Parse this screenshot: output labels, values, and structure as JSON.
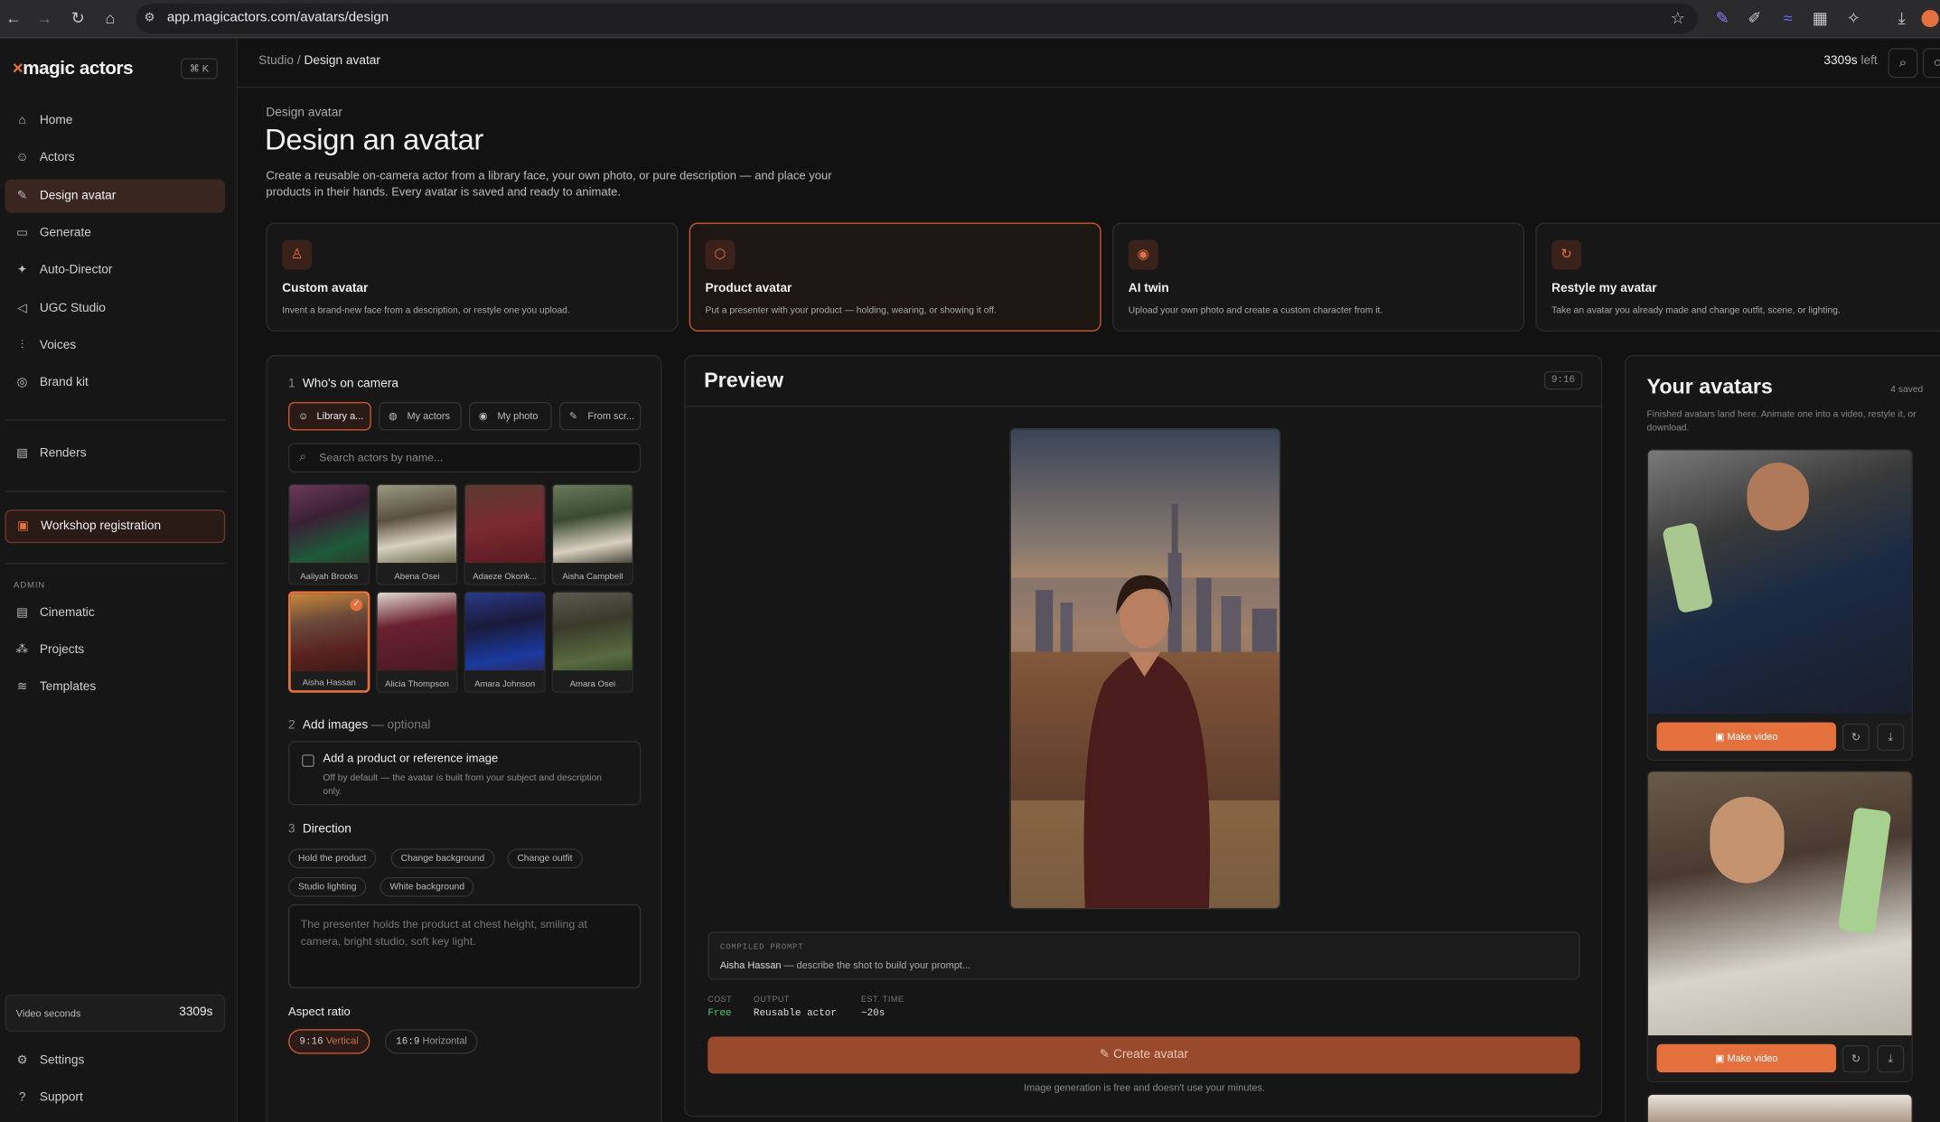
{
  "browser": {
    "url": "app.magicactors.com/avatars/design"
  },
  "sidebar": {
    "logo": "magic actors",
    "shortcut": "⌘ K",
    "items": [
      {
        "label": "Home",
        "icon": "home-icon"
      },
      {
        "label": "Actors",
        "icon": "users-icon"
      },
      {
        "label": "Design avatar",
        "icon": "wand-icon"
      },
      {
        "label": "Generate",
        "icon": "video-icon"
      },
      {
        "label": "Auto-Director",
        "icon": "sparkle-icon"
      },
      {
        "label": "UGC Studio",
        "icon": "megaphone-icon"
      },
      {
        "label": "Voices",
        "icon": "waveform-icon"
      },
      {
        "label": "Brand kit",
        "icon": "palette-icon"
      },
      {
        "label": "Renders",
        "icon": "film-icon"
      }
    ],
    "workshop": "Workshop registration",
    "admin_label": "ADMIN",
    "admin_items": [
      {
        "label": "Cinematic"
      },
      {
        "label": "Projects"
      },
      {
        "label": "Templates"
      }
    ],
    "video_seconds_label": "Video seconds",
    "video_seconds_value": "3309s",
    "settings": "Settings",
    "support": "Support"
  },
  "topbar": {
    "crumb_root": "Studio",
    "crumb_sep": "/",
    "crumb_current": "Design avatar",
    "seconds_left": "3309s",
    "seconds_left_suffix": "left"
  },
  "header": {
    "eyebrow": "Design avatar",
    "title": "Design an avatar",
    "description": "Create a reusable on-camera actor from a library face, your own photo, or pure description — and place your products in their hands. Every avatar is saved and ready to animate."
  },
  "modes": [
    {
      "title": "Custom avatar",
      "desc": "Invent a brand-new face from a description, or restyle one you upload.",
      "icon": "person-icon"
    },
    {
      "title": "Product avatar",
      "desc": "Put a presenter with your product — holding, wearing, or showing it off.",
      "icon": "box-icon"
    },
    {
      "title": "AI twin",
      "desc": "Upload your own photo and create a custom character from it.",
      "icon": "camera-icon"
    },
    {
      "title": "Restyle my avatar",
      "desc": "Take an avatar you already made and change outfit, scene, or lighting.",
      "icon": "refresh-icon"
    }
  ],
  "who": {
    "num": "1",
    "title": "Who's on camera",
    "tabs": [
      "Library a...",
      "My actors",
      "My photo",
      "From scr..."
    ],
    "search_placeholder": "Search actors by name...",
    "actors": [
      "Aaliyah Brooks",
      "Abena Osei",
      "Adaeze Okonk...",
      "Aisha Campbell",
      "Aisha Hassan",
      "Alicia Thompson",
      "Amara Johnson",
      "Amara Osei"
    ]
  },
  "images": {
    "num": "2",
    "title": "Add images",
    "optional": "— optional",
    "checkbox_label": "Add a product or reference image",
    "checkbox_desc": "Off by default — the avatar is built from your subject and description only."
  },
  "direction": {
    "num": "3",
    "title": "Direction",
    "chips": [
      "Hold the product",
      "Change background",
      "Change outfit",
      "Studio lighting",
      "White background"
    ],
    "placeholder": "The presenter holds the product at chest height, smiling at camera, bright studio, soft key light."
  },
  "aspect": {
    "label": "Aspect ratio",
    "options": [
      {
        "ratio": "9:16",
        "name": "Vertical"
      },
      {
        "ratio": "16:9",
        "name": "Horizontal"
      }
    ]
  },
  "preview": {
    "title": "Preview",
    "ratio": "9:16",
    "compiled_label": "COMPILED PROMPT",
    "compiled_name": "Aisha Hassan",
    "compiled_rest": " — describe the shot to build your prompt...",
    "cost_label": "COST",
    "cost_value": "Free",
    "output_label": "OUTPUT",
    "output_value": "Reusable actor",
    "time_label": "EST. TIME",
    "time_value": "~20s",
    "create_label": "Create avatar",
    "footnote": "Image generation is free and doesn't use your minutes."
  },
  "your_avatars": {
    "title": "Your avatars",
    "count": "4 saved",
    "desc": "Finished avatars land here. Animate one into a video, restyle it, or download.",
    "make_video": "Make video"
  },
  "colors": {
    "accent": "#e4703e",
    "bg": "#121212",
    "panel": "#171717"
  }
}
